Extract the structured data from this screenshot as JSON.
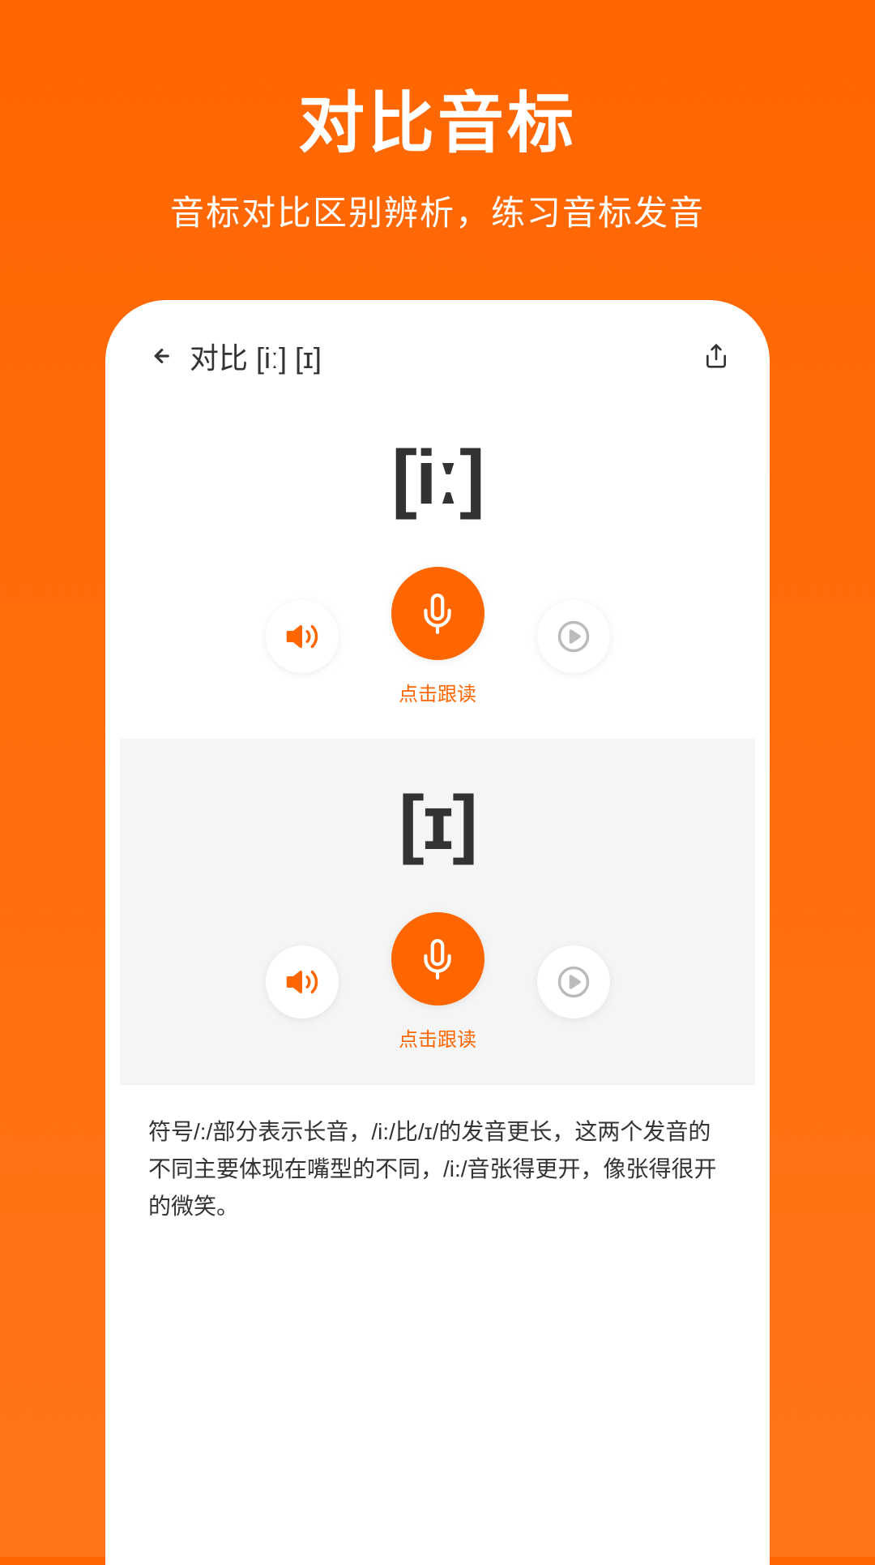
{
  "promo": {
    "title": "对比音标",
    "subtitle": "音标对比区别辨析，练习音标发音"
  },
  "app": {
    "header": {
      "title": "对比 [iː] [ɪ]"
    },
    "phonemes": [
      {
        "symbol": "[iː]",
        "record_label": "点击跟读",
        "bg": "white"
      },
      {
        "symbol": "[ɪ]",
        "record_label": "点击跟读",
        "bg": "gray"
      }
    ],
    "description": "符号/:/部分表示长音，/i:/比/ɪ/的发音更长，这两个发音的不同主要体现在嘴型的不同，/i:/音张得更开，像张得很开的微笑。"
  }
}
